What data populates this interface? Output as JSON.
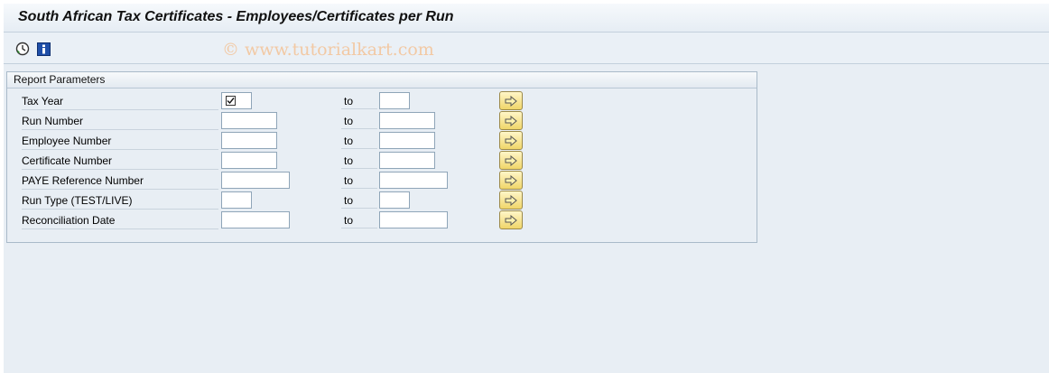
{
  "window": {
    "title": "South African Tax Certificates - Employees/Certificates per Run"
  },
  "toolbar": {
    "execute_icon": "execute-clock-icon",
    "info_icon": "info-icon",
    "watermark": "© www.tutorialkart.com"
  },
  "report_parameters": {
    "header": "Report Parameters",
    "to_label": "to",
    "rows": [
      {
        "label": "Tax Year",
        "from_value": "",
        "to_value": "",
        "from_checked": true
      },
      {
        "label": "Run Number",
        "from_value": "",
        "to_value": ""
      },
      {
        "label": "Employee Number",
        "from_value": "",
        "to_value": ""
      },
      {
        "label": "Certificate Number",
        "from_value": "",
        "to_value": ""
      },
      {
        "label": "PAYE Reference Number",
        "from_value": "",
        "to_value": ""
      },
      {
        "label": "Run Type (TEST/LIVE)",
        "from_value": "",
        "to_value": ""
      },
      {
        "label": "Reconciliation Date",
        "from_value": "",
        "to_value": ""
      }
    ]
  },
  "colors": {
    "background": "#dfe8f1",
    "arrow_button": "#f0d66a",
    "info_blue": "#1f4fa8"
  }
}
